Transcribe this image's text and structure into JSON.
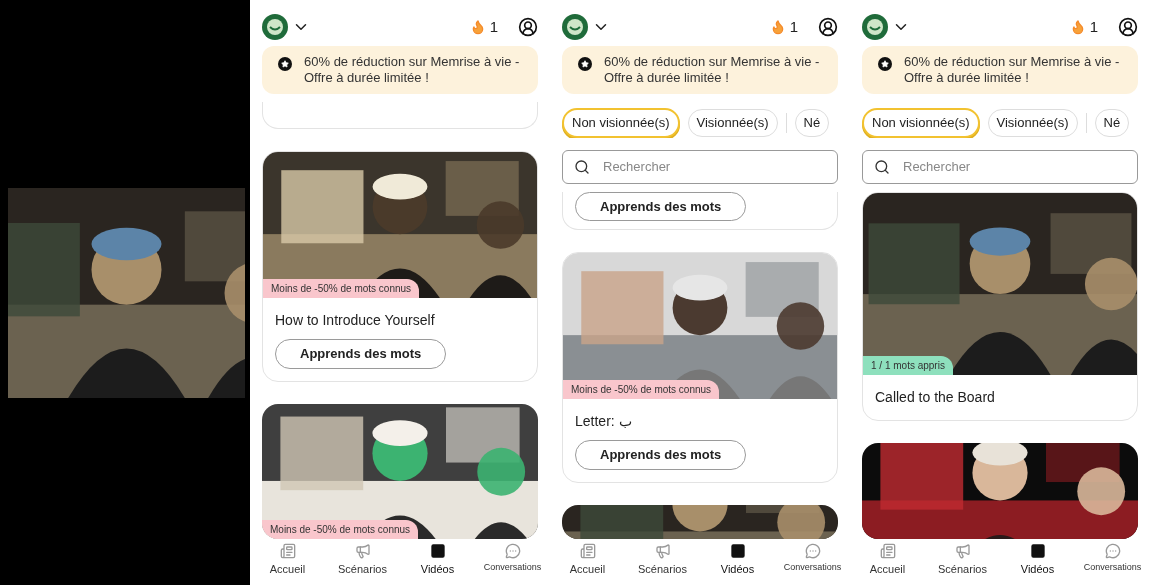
{
  "phones": [
    {
      "streak": "1",
      "banner": "60% de réduction sur Memrise à vie - Offre à durée limitée !",
      "cards": [
        {
          "kind": "stub"
        },
        {
          "kind": "full",
          "tag": {
            "text": "Moins de -50% de mots connus",
            "color": "#f9c6cc"
          },
          "title": "How to Introduce Yourself",
          "button": "Apprends des mots"
        },
        {
          "kind": "preview",
          "tag": {
            "text": "Moins de -50% de mots connus",
            "color": "#f9c6cc"
          }
        }
      ],
      "nav": [
        {
          "label": "Accueil",
          "selected": false
        },
        {
          "label": "Scénarios",
          "selected": false
        },
        {
          "label": "Vidéos",
          "selected": true
        },
        {
          "label": "Conversations",
          "selected": false
        }
      ]
    },
    {
      "streak": "1",
      "banner": "60% de réduction sur Memrise à vie - Offre à durée limitée !",
      "filters": [
        {
          "label": "Non visionnée(s)",
          "selected": true
        },
        {
          "label": "Visionnée(s)",
          "selected": false
        },
        {
          "label": "Né",
          "selected": false
        }
      ],
      "search": {
        "placeholder": "Rechercher"
      },
      "cards": [
        {
          "kind": "stub",
          "button": "Apprends des mots"
        },
        {
          "kind": "full",
          "tag": {
            "text": "Moins de -50% de mots connus",
            "color": "#f9c6cc"
          },
          "title": "Letter: ب",
          "button": "Apprends des mots"
        },
        {
          "kind": "preview"
        }
      ],
      "nav": [
        {
          "label": "Accueil",
          "selected": false
        },
        {
          "label": "Scénarios",
          "selected": false
        },
        {
          "label": "Vidéos",
          "selected": true
        },
        {
          "label": "Conversations",
          "selected": false
        }
      ]
    },
    {
      "streak": "1",
      "banner": "60% de réduction sur Memrise à vie - Offre à durée limitée !",
      "filters": [
        {
          "label": "Non visionnée(s)",
          "selected": true
        },
        {
          "label": "Visionnée(s)",
          "selected": false
        },
        {
          "label": "Né",
          "selected": false
        }
      ],
      "search": {
        "placeholder": "Rechercher"
      },
      "cards": [
        {
          "kind": "full",
          "tag": {
            "text": "1 / 1 mots appris",
            "color": "#8ee0bd"
          },
          "title": "Called to the Board"
        },
        {
          "kind": "preview"
        }
      ],
      "nav": [
        {
          "label": "Accueil",
          "selected": false
        },
        {
          "label": "Scénarios",
          "selected": false
        },
        {
          "label": "Vidéos",
          "selected": true
        },
        {
          "label": "Conversations",
          "selected": false
        }
      ]
    }
  ]
}
